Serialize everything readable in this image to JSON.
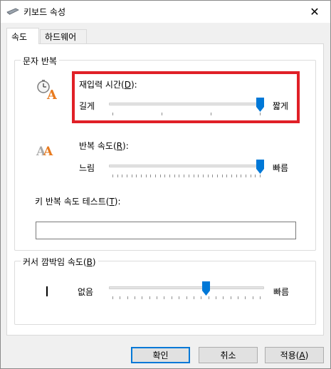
{
  "window": {
    "title": "키보드 속성",
    "close_glyph": "✕"
  },
  "tabs": [
    {
      "label": "속도",
      "active": true
    },
    {
      "label": "하드웨어",
      "active": false
    }
  ],
  "char_repeat": {
    "group_label": "문자 반복",
    "delay": {
      "label_prefix": "재입력 시간(",
      "accel": "D",
      "label_suffix": "):",
      "left": "길게",
      "right": "짧게",
      "level": 1.0
    },
    "rate": {
      "label_prefix": "반복 속도(",
      "accel": "R",
      "label_suffix": "):",
      "left": "느림",
      "right": "빠름",
      "level": 1.0
    },
    "test": {
      "label_prefix": "키 반복 속도 테스트(",
      "accel": "T",
      "label_suffix": "):",
      "value": ""
    }
  },
  "cursor_blink": {
    "group_label_prefix": "커서 깜박임 속도(",
    "accel": "B",
    "group_label_suffix": ")",
    "left": "없음",
    "right": "빠름",
    "level": 0.6
  },
  "buttons": {
    "ok": "확인",
    "cancel": "취소",
    "apply_prefix": "적용(",
    "apply_accel": "A",
    "apply_suffix": ")"
  },
  "colors": {
    "accent": "#0078d7",
    "highlight": "#e02027"
  }
}
